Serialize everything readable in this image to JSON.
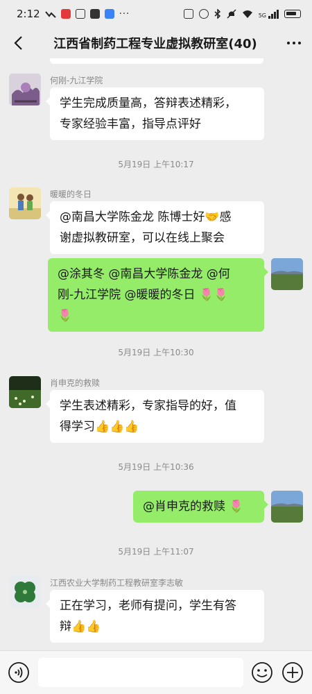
{
  "status_bar": {
    "time": "2:12",
    "network": "5G",
    "icons_left": [
      "app-notification-icon",
      "image-icon",
      "app-icon",
      "cloud-icon",
      "more-notifications-icon"
    ],
    "icons_right": [
      "nfc-icon",
      "alarm-icon",
      "bluetooth-icon",
      "silent-icon",
      "wifi-icon",
      "signal-icon",
      "battery-icon"
    ]
  },
  "header": {
    "title": "江西省制药工程专业虚拟教研室(40)",
    "back_icon": "chevron-left-icon",
    "more_icon": "more-dots-icon"
  },
  "messages": [
    {
      "sender": "何刚-九江学院",
      "lines": [
        "学生完成质量高，答辩表述精彩，",
        "专家经验丰富，指导点评好"
      ]
    },
    {
      "timestamp": "5月19日 上午10:17"
    },
    {
      "sender": "暖暖的冬日",
      "lines": [
        "@南昌大学陈金龙  陈博士好🤝感",
        "谢虚拟教研室，可以在线上聚会"
      ]
    },
    {
      "lines": [
        "@涂其冬  @南昌大学陈金龙  @何",
        "刚-九江学院  @暖暖的冬日  🌷🌷",
        "🌷"
      ]
    },
    {
      "timestamp": "5月19日 上午10:30"
    },
    {
      "sender": "肖申克的救赎",
      "lines": [
        "学生表述精彩，专家指导的好，值",
        "得学习👍👍👍"
      ]
    },
    {
      "timestamp": "5月19日 上午10:36"
    },
    {
      "lines": [
        "@肖申克的救赎  🌷"
      ]
    },
    {
      "timestamp": "5月19日 上午11:07"
    },
    {
      "sender": "江西农业大学制药工程教研室李志敏",
      "lines": [
        "正在学习，老师有提问，学生有答",
        "辩👍👍"
      ]
    }
  ],
  "input_bar": {
    "voice_icon": "voice-icon",
    "emoji_icon": "emoji-icon",
    "plus_icon": "plus-icon",
    "value": "",
    "placeholder": ""
  }
}
